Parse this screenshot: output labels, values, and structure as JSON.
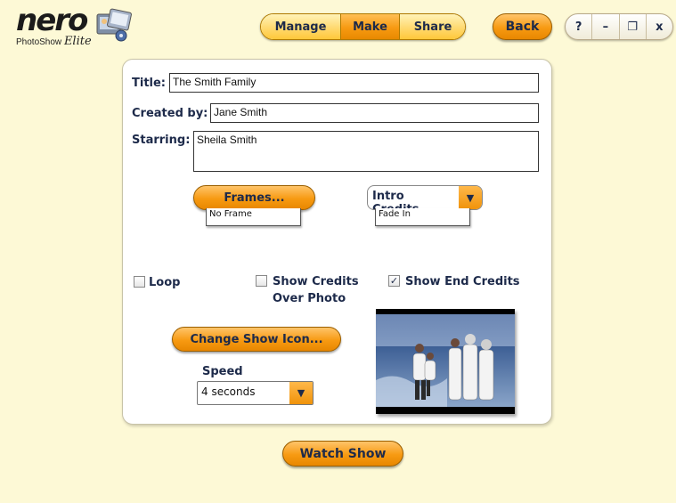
{
  "app": {
    "logo_word": "nero",
    "logo_sub": "PhotoShow",
    "logo_edition": "Elite"
  },
  "nav": {
    "tabs": [
      {
        "label": "Manage",
        "active": false
      },
      {
        "label": "Make",
        "active": true
      },
      {
        "label": "Share",
        "active": false
      }
    ],
    "back_label": "Back",
    "help_label": "?",
    "minimize_label": "–",
    "restore_label": "❐",
    "close_label": "x"
  },
  "form": {
    "title_label": "Title:",
    "title_value": "The Smith Family",
    "created_label": "Created by:",
    "created_value": "Jane Smith",
    "starring_label": "Starring:",
    "starring_value": "Sheila Smith"
  },
  "frames": {
    "button_label": "Frames...",
    "value": "No Frame"
  },
  "credits": {
    "select_label": "Intro Credits",
    "value": "Fade In"
  },
  "options": {
    "loop_label": "Loop",
    "loop_checked": false,
    "show_credits_label_1": "Show Credits",
    "show_credits_label_2": "Over Photo",
    "show_credits_checked": false,
    "end_credits_label": "Show End Credits",
    "end_credits_checked": true
  },
  "show_icon": {
    "button_label": "Change Show Icon..."
  },
  "speed": {
    "label": "Speed",
    "value": "4 seconds"
  },
  "watch": {
    "button_label": "Watch Show"
  },
  "colors": {
    "background": "#fdf9d6",
    "accent": "#f79a12",
    "nav_light": "#ffd970",
    "text_dark": "#1d2a4a"
  }
}
